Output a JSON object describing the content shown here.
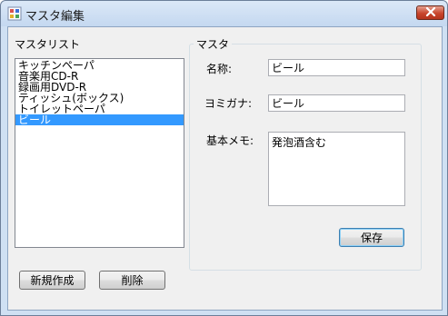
{
  "window": {
    "title": "マスタ編集"
  },
  "master_list": {
    "label": "マスタリスト",
    "items": [
      {
        "label": "キッチンペーパ",
        "selected": false
      },
      {
        "label": "音楽用CD-R",
        "selected": false
      },
      {
        "label": "録画用DVD-R",
        "selected": false
      },
      {
        "label": "ティッシュ(ボックス)",
        "selected": false
      },
      {
        "label": "トイレットペーパ",
        "selected": false
      },
      {
        "label": "ビール",
        "selected": true
      }
    ]
  },
  "master_group": {
    "legend": "マスタ",
    "name_label": "名称:",
    "name_value": "ビール",
    "kana_label": "ヨミガナ:",
    "kana_value": "ビール",
    "memo_label": "基本メモ:",
    "memo_value": "発泡酒含む",
    "save_label": "保存"
  },
  "footer": {
    "new_label": "新規作成",
    "delete_label": "削除"
  },
  "colors": {
    "selection": "#3399ff",
    "close_button": "#c8452c"
  },
  "icons": {
    "app": "app-icon",
    "close": "close-icon"
  }
}
